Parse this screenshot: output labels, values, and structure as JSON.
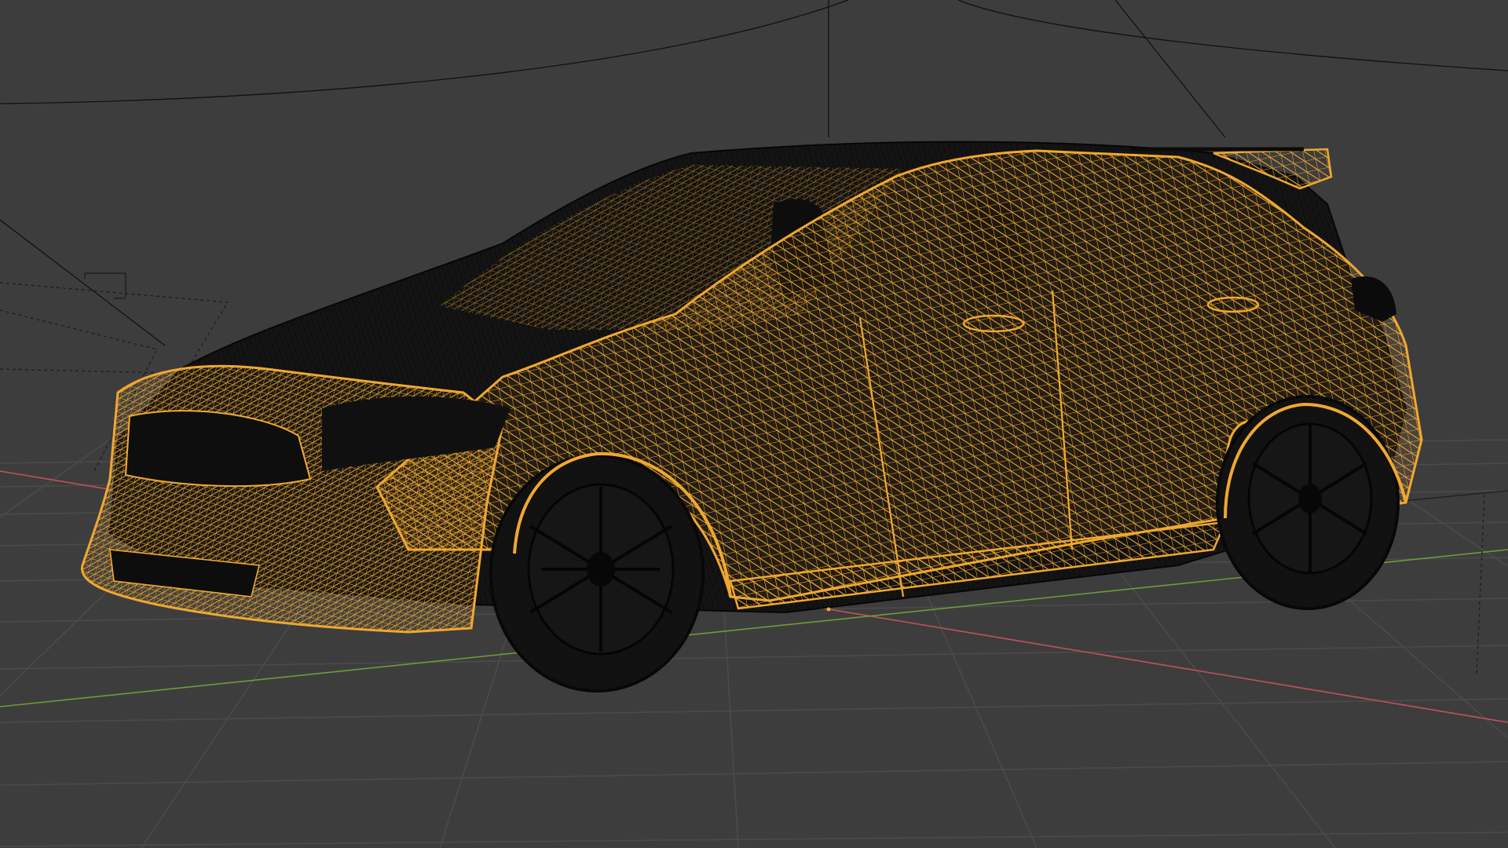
{
  "viewport": {
    "mode": "wireframe",
    "background_color": "#3d3d3d",
    "grid_color": "#4a4a4a",
    "grid_visible": true,
    "axis_x_color": "#c0545a",
    "axis_y_color": "#6f9a3c",
    "selection_color": "#f0a830",
    "unselected_wire_color": "#0c0c0c"
  },
  "scene": {
    "object": "car-wireframe",
    "object_state": "selected",
    "helpers": [
      "camera-outline",
      "light-object",
      "circle-guide"
    ]
  }
}
